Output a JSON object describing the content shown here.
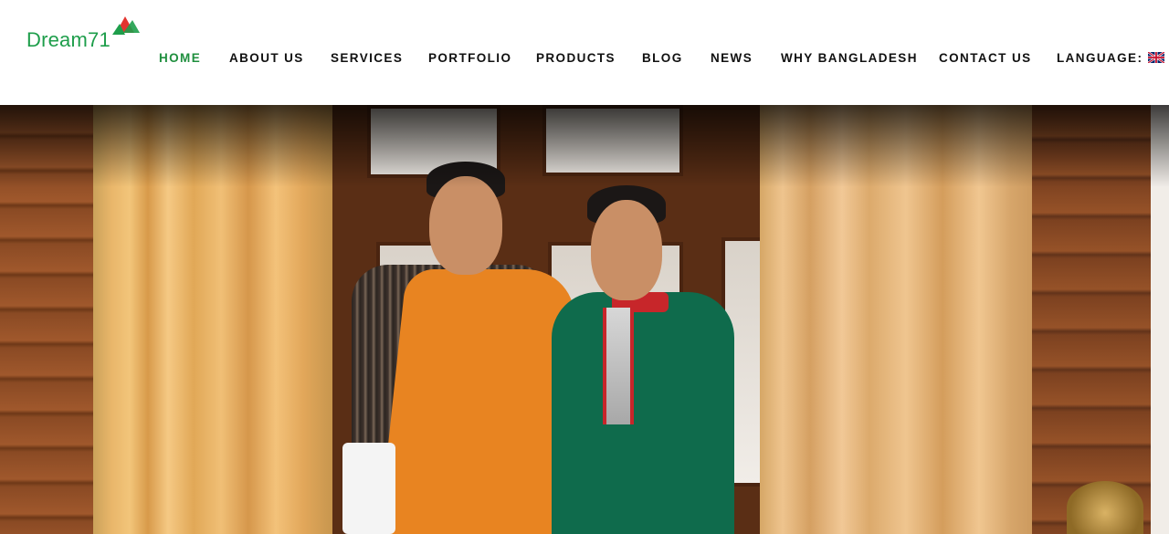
{
  "brand": {
    "name": "Dream71",
    "colors": {
      "green": "#1e9e4b",
      "red": "#e3342f",
      "dark": "#111111"
    }
  },
  "nav": {
    "items": [
      {
        "label": "HOME",
        "active": true
      },
      {
        "label": "ABOUT US"
      },
      {
        "label": "SERVICES"
      },
      {
        "label": "PORTFOLIO"
      },
      {
        "label": "PRODUCTS"
      },
      {
        "label": "BLOG"
      },
      {
        "label": "NEWS"
      },
      {
        "label": "WHY BANGLADESH"
      },
      {
        "label": "CONTACT US"
      },
      {
        "label": "LANGUAGE:"
      }
    ],
    "language_flag_icon": "uk-flag-icon"
  },
  "hero": {
    "image": "photo-two-men-in-traditional-dress"
  }
}
